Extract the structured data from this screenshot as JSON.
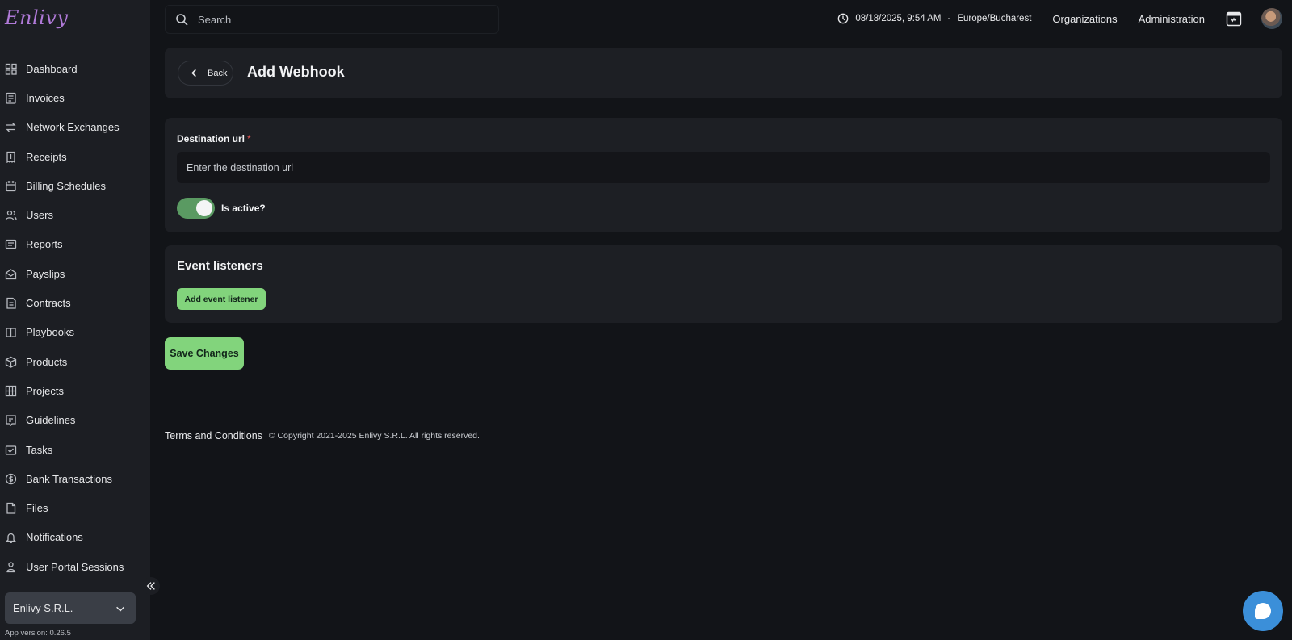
{
  "app": {
    "logo_text": "Enlivy",
    "version_text": "App version: 0.26.5"
  },
  "sidebar": {
    "items": [
      {
        "label": "Dashboard",
        "icon": "dashboard-icon"
      },
      {
        "label": "Invoices",
        "icon": "invoice-icon"
      },
      {
        "label": "Network Exchanges",
        "icon": "network-exchange-icon"
      },
      {
        "label": "Receipts",
        "icon": "receipt-icon"
      },
      {
        "label": "Billing Schedules",
        "icon": "billing-schedule-icon"
      },
      {
        "label": "Users",
        "icon": "users-icon"
      },
      {
        "label": "Reports",
        "icon": "reports-icon"
      },
      {
        "label": "Payslips",
        "icon": "payslip-icon"
      },
      {
        "label": "Contracts",
        "icon": "contract-icon"
      },
      {
        "label": "Playbooks",
        "icon": "playbook-icon"
      },
      {
        "label": "Products",
        "icon": "product-icon"
      },
      {
        "label": "Projects",
        "icon": "project-icon"
      },
      {
        "label": "Guidelines",
        "icon": "guideline-icon"
      },
      {
        "label": "Tasks",
        "icon": "task-icon"
      },
      {
        "label": "Bank Transactions",
        "icon": "bank-transaction-icon"
      },
      {
        "label": "Files",
        "icon": "file-icon"
      },
      {
        "label": "Notifications",
        "icon": "notification-icon"
      },
      {
        "label": "User Portal Sessions",
        "icon": "user-portal-session-icon"
      }
    ],
    "organization": "Enlivy S.R.L."
  },
  "topbar": {
    "search_placeholder": "Search",
    "datetime": "08/18/2025, 9:54 AM",
    "separator": "-",
    "timezone": "Europe/Bucharest",
    "organizations_label": "Organizations",
    "administration_label": "Administration"
  },
  "header": {
    "back_label": "Back",
    "title": "Add Webhook"
  },
  "form": {
    "destination_label": "Destination url",
    "required_mark": "*",
    "destination_placeholder": "Enter the destination url",
    "destination_value": "",
    "is_active_label": "Is active?",
    "is_active": true
  },
  "events": {
    "title": "Event listeners",
    "add_button_label": "Add event listener"
  },
  "actions": {
    "save_label": "Save Changes"
  },
  "footer": {
    "terms_label": "Terms and Conditions",
    "copyright": "© Copyright 2021-2025 Enlivy S.R.L. All rights reserved."
  },
  "colors": {
    "accent_green": "#82d47c",
    "toggle_green": "#5a9a62",
    "background": "#121418",
    "panel": "#1d1f24",
    "sidebar": "#1c1e23",
    "chat_blue": "#3b8fd9",
    "required_red": "#e05353"
  }
}
